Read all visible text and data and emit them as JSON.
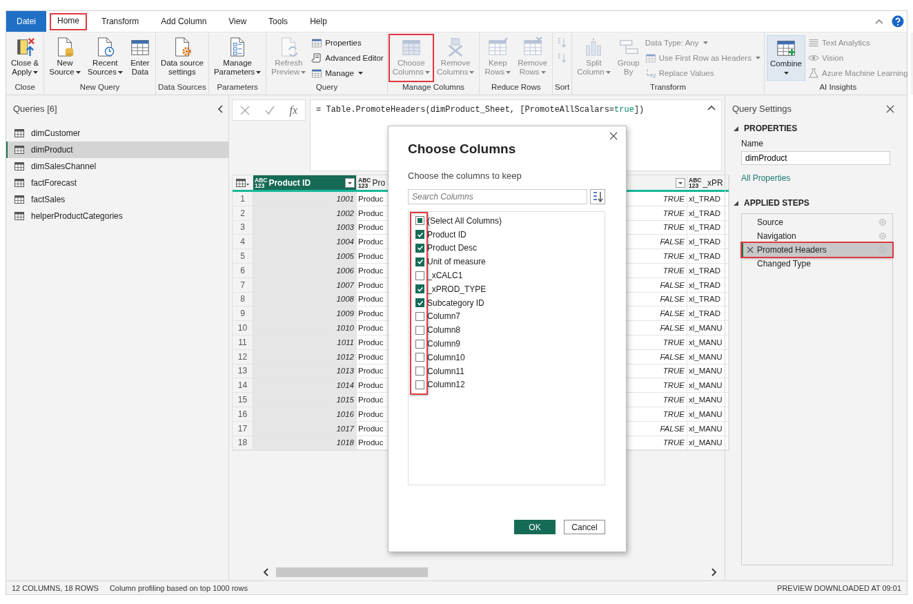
{
  "tabs": [
    {
      "label": "Datei",
      "kind": "file",
      "selected": false,
      "highlighted": false
    },
    {
      "label": "Home",
      "kind": "tab",
      "selected": true,
      "highlighted": true
    },
    {
      "label": "Transform",
      "kind": "tab",
      "selected": false,
      "highlighted": false
    },
    {
      "label": "Add Column",
      "kind": "tab",
      "selected": false,
      "highlighted": false
    },
    {
      "label": "View",
      "kind": "tab",
      "selected": false,
      "highlighted": false
    },
    {
      "label": "Tools",
      "kind": "tab",
      "selected": false,
      "highlighted": false
    },
    {
      "label": "Help",
      "kind": "tab",
      "selected": false,
      "highlighted": false
    }
  ],
  "ribbon_groups": [
    {
      "label": "Close",
      "items": [
        {
          "kind": "large",
          "label": "Close &\nApply",
          "dropdown": true,
          "disabled": false,
          "active": false,
          "highlighted": false
        }
      ]
    },
    {
      "label": "New Query",
      "items": [
        {
          "kind": "large",
          "label": "New\nSource",
          "dropdown": true,
          "disabled": false,
          "active": false,
          "highlighted": false
        },
        {
          "kind": "large",
          "label": "Recent\nSources",
          "dropdown": true,
          "disabled": false,
          "active": false,
          "highlighted": false
        },
        {
          "kind": "large",
          "label": "Enter\nData",
          "dropdown": false,
          "disabled": false,
          "active": false,
          "highlighted": false
        }
      ]
    },
    {
      "label": "Data Sources",
      "items": [
        {
          "kind": "large",
          "label": "Data source\nsettings",
          "dropdown": false,
          "disabled": false,
          "active": false,
          "highlighted": false
        }
      ]
    },
    {
      "label": "Parameters",
      "items": [
        {
          "kind": "large",
          "label": "Manage\nParameters",
          "dropdown": true,
          "disabled": false,
          "active": false,
          "highlighted": false
        }
      ]
    },
    {
      "label": "Query",
      "items": [
        {
          "kind": "large",
          "label": "Refresh\nPreview",
          "dropdown": true,
          "disabled": true,
          "active": false,
          "highlighted": false
        },
        {
          "kind": "stack",
          "items": [
            {
              "label": "Properties",
              "dropdown": false,
              "disabled": false
            },
            {
              "label": "Advanced Editor",
              "dropdown": false,
              "disabled": false
            },
            {
              "label": "Manage",
              "dropdown": true,
              "disabled": false
            }
          ]
        }
      ]
    },
    {
      "label": "Manage Columns",
      "items": [
        {
          "kind": "large",
          "label": "Choose\nColumns",
          "dropdown": true,
          "disabled": true,
          "active": false,
          "highlighted": true
        },
        {
          "kind": "large",
          "label": "Remove\nColumns",
          "dropdown": true,
          "disabled": true,
          "active": false,
          "highlighted": false
        }
      ]
    },
    {
      "label": "Reduce Rows",
      "items": [
        {
          "kind": "large",
          "label": "Keep\nRows",
          "dropdown": true,
          "disabled": true,
          "active": false,
          "highlighted": false
        },
        {
          "kind": "large",
          "label": "Remove\nRows",
          "dropdown": true,
          "disabled": true,
          "active": false,
          "highlighted": false
        }
      ]
    },
    {
      "label": "Sort",
      "items": [
        {
          "kind": "stack",
          "items": [
            {
              "dropdown": false,
              "disabled": true
            },
            {
              "dropdown": false,
              "disabled": true
            }
          ]
        }
      ]
    },
    {
      "label": "Transform",
      "items": [
        {
          "kind": "large",
          "label": "Split\nColumn",
          "dropdown": true,
          "disabled": true,
          "active": false,
          "highlighted": false
        },
        {
          "kind": "large",
          "label": "Group\nBy",
          "dropdown": false,
          "disabled": true,
          "active": false,
          "highlighted": false
        },
        {
          "kind": "stack",
          "items": [
            {
              "label": "Data Type: Any",
              "dropdown": true,
              "disabled": true
            },
            {
              "label": "Use First Row as Headers",
              "dropdown": true,
              "disabled": true
            },
            {
              "label": "Replace Values",
              "dropdown": false,
              "disabled": true
            }
          ]
        }
      ]
    },
    {
      "label": "AI Insights",
      "items": [
        {
          "kind": "large",
          "label": "Combine",
          "dropdown": true,
          "disabled": false,
          "active": true,
          "highlighted": false
        },
        {
          "kind": "stack",
          "items": [
            {
              "label": "Text Analytics",
              "dropdown": false,
              "disabled": true
            },
            {
              "label": "Vision",
              "dropdown": false,
              "disabled": true
            },
            {
              "label": "Azure Machine Learning",
              "dropdown": false,
              "disabled": true
            }
          ]
        }
      ]
    }
  ],
  "queries": {
    "title": "Queries [6]",
    "items": [
      {
        "label": "dimCustomer",
        "selected": false
      },
      {
        "label": "dimProduct",
        "selected": true
      },
      {
        "label": "dimSalesChannel",
        "selected": false
      },
      {
        "label": "factForecast",
        "selected": false
      },
      {
        "label": "factSales",
        "selected": false
      },
      {
        "label": "helperProductCategories",
        "selected": false
      }
    ]
  },
  "formula_bar": {
    "fx_label": "fx",
    "formula": [
      {
        "text": "= Table.PromoteHeaders(dimProduct_Sheet, [PromoteAllScalars=",
        "kind": "code"
      },
      {
        "text": "true",
        "kind": "keyword"
      },
      {
        "text": "])",
        "kind": "code"
      }
    ]
  },
  "table": {
    "columns": [
      {
        "header": "Product ID",
        "type_badge": "ABC\n123",
        "selected": true,
        "dropdown": true
      },
      {
        "header": "Pro",
        "type_badge": "ABC\n123",
        "selected": false
      },
      {
        "selected": false,
        "dropdown": true
      },
      {
        "header": "_xPR",
        "type_badge": "ABC\n123",
        "selected": false
      }
    ],
    "rows": [
      {
        "number": "1",
        "cells": [
          "1001",
          "Produc",
          "TRUE",
          "xl_TRAD"
        ]
      },
      {
        "number": "2",
        "cells": [
          "1002",
          "Produc",
          "TRUE",
          "xl_TRAD"
        ]
      },
      {
        "number": "3",
        "cells": [
          "1003",
          "Produc",
          "TRUE",
          "xl_TRAD"
        ]
      },
      {
        "number": "4",
        "cells": [
          "1004",
          "Produc",
          "FALSE",
          "xl_TRAD"
        ]
      },
      {
        "number": "5",
        "cells": [
          "1005",
          "Produc",
          "TRUE",
          "xl_TRAD"
        ]
      },
      {
        "number": "6",
        "cells": [
          "1006",
          "Produc",
          "TRUE",
          "xl_TRAD"
        ]
      },
      {
        "number": "7",
        "cells": [
          "1007",
          "Produc",
          "FALSE",
          "xl_TRAD"
        ]
      },
      {
        "number": "8",
        "cells": [
          "1008",
          "Produc",
          "FALSE",
          "xl_TRAD"
        ]
      },
      {
        "number": "9",
        "cells": [
          "1009",
          "Produc",
          "FALSE",
          "xl_TRAD"
        ]
      },
      {
        "number": "10",
        "cells": [
          "1010",
          "Produc",
          "FALSE",
          "xl_MANU"
        ]
      },
      {
        "number": "11",
        "cells": [
          "1011",
          "Produc",
          "TRUE",
          "xl_MANU"
        ]
      },
      {
        "number": "12",
        "cells": [
          "1012",
          "Produc",
          "FALSE",
          "xl_MANU"
        ]
      },
      {
        "number": "13",
        "cells": [
          "1013",
          "Produc",
          "TRUE",
          "xl_MANU"
        ]
      },
      {
        "number": "14",
        "cells": [
          "1014",
          "Produc",
          "TRUE",
          "xl_MANU"
        ]
      },
      {
        "number": "15",
        "cells": [
          "1015",
          "Produc",
          "TRUE",
          "xl_MANU"
        ]
      },
      {
        "number": "16",
        "cells": [
          "1016",
          "Produc",
          "TRUE",
          "xl_MANU"
        ]
      },
      {
        "number": "17",
        "cells": [
          "1017",
          "Produc",
          "FALSE",
          "xl_MANU"
        ]
      },
      {
        "number": "18",
        "cells": [
          "1018",
          "Produc",
          "TRUE",
          "xl_MANU"
        ]
      }
    ]
  },
  "dialog": {
    "title": "Choose Columns",
    "subtitle": "Choose the columns to keep",
    "search": {
      "placeholder": "Search Columns"
    },
    "checkboxes_highlighted": true,
    "columns": [
      {
        "label": "(Select All Columns)",
        "kind": "select_all",
        "checked": false,
        "indeterminate": true
      },
      {
        "label": "Product ID",
        "kind": "column",
        "checked": true
      },
      {
        "label": "Product Desc",
        "kind": "column",
        "checked": true
      },
      {
        "label": "Unit of measure",
        "kind": "column",
        "checked": true
      },
      {
        "label": "_xCALC1",
        "kind": "column",
        "checked": false
      },
      {
        "label": "_xPROD_TYPE",
        "kind": "column",
        "checked": true
      },
      {
        "label": "Subcategory ID",
        "kind": "column",
        "checked": true
      },
      {
        "label": "Column7",
        "kind": "column",
        "checked": false
      },
      {
        "label": "Column8",
        "kind": "column",
        "checked": false
      },
      {
        "label": "Column9",
        "kind": "column",
        "checked": false
      },
      {
        "label": "Column10",
        "kind": "column",
        "checked": false
      },
      {
        "label": "Column11",
        "kind": "column",
        "checked": false
      },
      {
        "label": "Column12",
        "kind": "column",
        "checked": false
      }
    ],
    "buttons": [
      {
        "label": "OK",
        "kind": "primary"
      },
      {
        "label": "Cancel",
        "kind": "secondary"
      }
    ]
  },
  "query_settings": {
    "title": "Query Settings",
    "properties": {
      "heading": "PROPERTIES",
      "name_label": "Name",
      "name_value": "dimProduct",
      "link": "All Properties"
    },
    "applied_steps": {
      "heading": "APPLIED STEPS",
      "steps": [
        {
          "label": "Source",
          "selected": false,
          "highlighted": false,
          "gear": true
        },
        {
          "label": "Navigation",
          "selected": false,
          "highlighted": false,
          "gear": true
        },
        {
          "label": "Promoted Headers",
          "selected": true,
          "highlighted": true,
          "gear": true
        },
        {
          "label": "Changed Type",
          "selected": false,
          "highlighted": false,
          "gear": false
        }
      ]
    }
  },
  "status_bar": {
    "columns_rows": "12 COLUMNS, 18 ROWS",
    "profiling": "Column profiling based on top 1000 rows",
    "preview": "PREVIEW DOWNLOADED AT 09:01"
  }
}
